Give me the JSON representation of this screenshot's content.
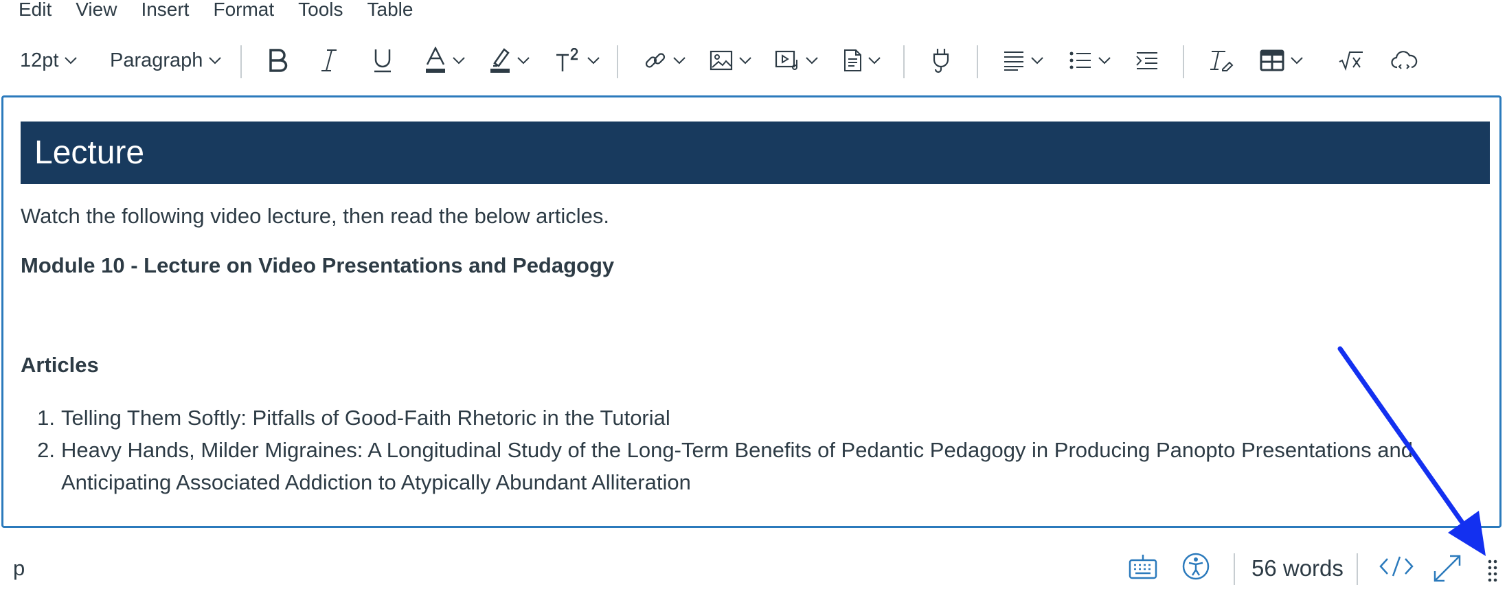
{
  "menubar": {
    "items": [
      "Edit",
      "View",
      "Insert",
      "Format",
      "Tools",
      "Table"
    ]
  },
  "toolbar": {
    "font_size": "12pt",
    "block_format": "Paragraph",
    "icons": [
      "bold-icon",
      "italic-icon",
      "underline-icon",
      "text-color-icon",
      "highlight-icon",
      "superscript-icon",
      "link-icon",
      "image-icon",
      "media-icon",
      "document-icon",
      "plugin-icon",
      "align-icon",
      "list-icon",
      "indent-icon",
      "clear-format-icon",
      "table-icon",
      "equation-icon",
      "cloud-icon"
    ]
  },
  "content": {
    "banner_title": "Lecture",
    "intro": "Watch the following video lecture, then read the below articles.",
    "module_link": "Module 10 - Lecture on Video Presentations and Pedagogy",
    "articles_heading": "Articles",
    "articles": [
      {
        "num": "1.",
        "text": "Telling Them Softly: Pitfalls of Good-Faith Rhetoric in the Tutorial"
      },
      {
        "num": "2.",
        "text": "Heavy Hands, Milder Migraines: A Longitudinal Study of the Long-Term Benefits of Pedantic Pedagogy in Producing Panopto Presentations and Anticipating Associated Addiction to Atypically Abundant Alliteration"
      }
    ]
  },
  "statusbar": {
    "path": "p",
    "word_count": "56 words",
    "html_toggle": "</>"
  },
  "colors": {
    "banner_bg": "#183a5e",
    "editor_border": "#2b7abc",
    "accent": "#2b7abc",
    "annotation_arrow": "#1330f0"
  }
}
